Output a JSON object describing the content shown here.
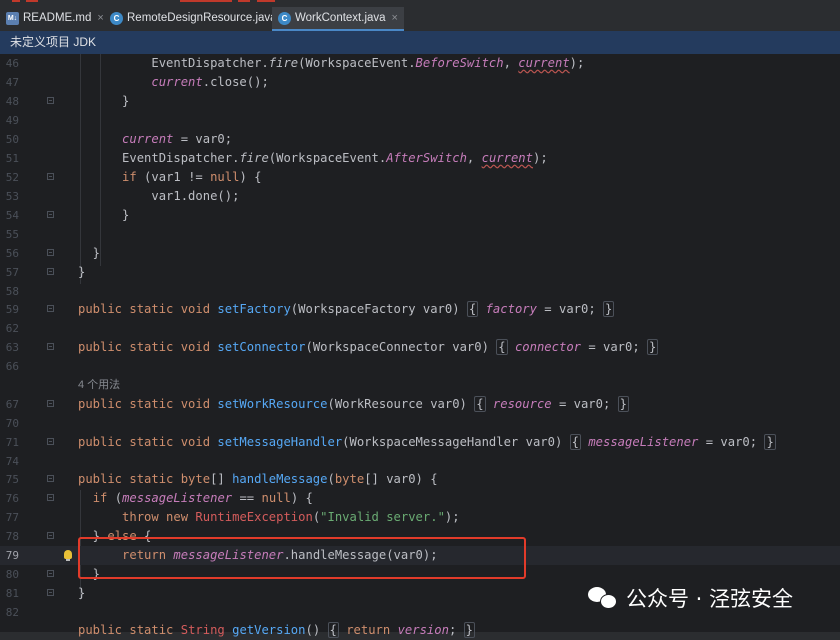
{
  "tabs": [
    {
      "label": "README.md",
      "icon": "markdown-file-icon",
      "close": "×",
      "active": false
    },
    {
      "label": "RemoteDesignResource.java",
      "icon": "java-class-icon",
      "close": "×",
      "active": false
    },
    {
      "label": "WorkContext.java",
      "icon": "java-class-icon",
      "close": "×",
      "active": true
    }
  ],
  "infobar": {
    "text": "未定义项目 JDK"
  },
  "hint": {
    "usages": "4 个用法"
  },
  "lines": {
    "l46": "46",
    "l47": "47",
    "l48": "48",
    "l49": "49",
    "l50": "50",
    "l51": "51",
    "l52": "52",
    "l53": "53",
    "l54": "54",
    "l55": "55",
    "l56": "56",
    "l57": "57",
    "l58": "58",
    "l59": "59",
    "l62": "62",
    "l63": "63",
    "l66": "66",
    "l67": "67",
    "l70": "70",
    "l71": "71",
    "l74": "74",
    "l75": "75",
    "l76": "76",
    "l77": "77",
    "l78": "78",
    "l79": "79",
    "l80": "80",
    "l81": "81",
    "l82": "82"
  },
  "watermark": {
    "text": "公众号 · 泾弦安全"
  },
  "colors": {
    "keyword": "#cf8e6d",
    "method": "#56a8f5",
    "field": "#c77dbb",
    "string": "#6aab73",
    "highlight_box": "#e23b2a"
  }
}
